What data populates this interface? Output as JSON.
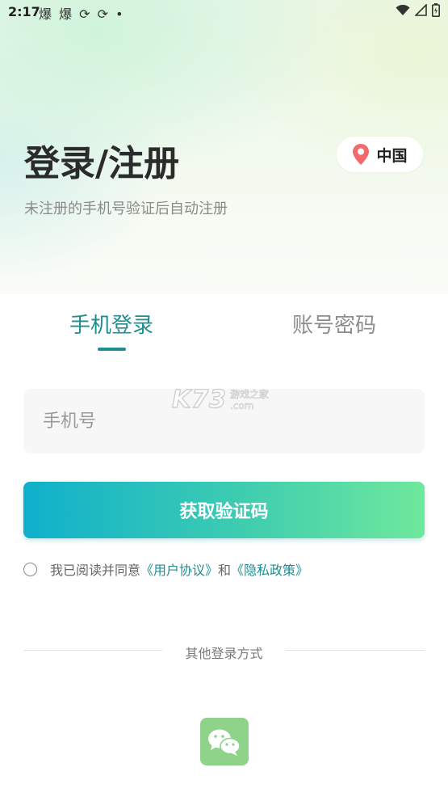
{
  "status_bar": {
    "time": "2:17",
    "notification_glyphs": "爆 爆 ⟳ ⟳ •"
  },
  "header": {
    "title": "登录/注册",
    "subtitle": "未注册的手机号验证后自动注册",
    "region": "中国"
  },
  "tabs": [
    {
      "label": "手机登录",
      "active": true
    },
    {
      "label": "账号密码",
      "active": false
    }
  ],
  "form": {
    "phone_placeholder": "手机号",
    "phone_value": "",
    "submit_label": "获取验证码"
  },
  "agreement": {
    "checked": false,
    "prefix": "我已阅读并同意",
    "user_agreement": "《用户协议》",
    "and": "和",
    "privacy_policy": "《隐私政策》"
  },
  "other_login": {
    "label": "其他登录方式",
    "methods": [
      {
        "icon": "wechat-icon"
      }
    ]
  },
  "watermark": {
    "main": "K73",
    "side_top": "游戏之家",
    "side_bottom": ".com"
  },
  "colors": {
    "accent": "#1f8e8f",
    "button_gradient_start": "#0fb0cc",
    "button_gradient_end": "#6ee89c",
    "wechat_bg": "#8fd28a",
    "location_pin": "#f26a6a"
  }
}
